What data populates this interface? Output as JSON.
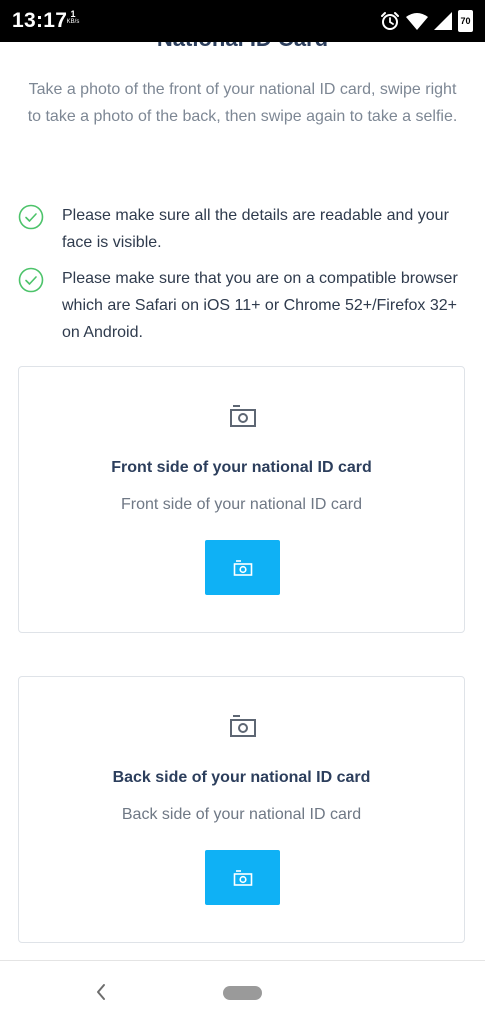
{
  "status_bar": {
    "time": "13:17",
    "net_speed_value": "1",
    "net_speed_unit": "KB/s",
    "battery_level": "70",
    "icons": [
      "alarm-icon",
      "wifi-icon",
      "signal-icon",
      "battery-icon"
    ]
  },
  "page": {
    "title": "National ID Card",
    "intro": "Take a photo of the front of your national ID card, swipe right to take a photo of the back, then swipe again to take a selfie."
  },
  "checklist": [
    {
      "icon": "check-circle-icon",
      "text": "Please make sure all the details are readable and your face is visible."
    },
    {
      "icon": "check-circle-icon",
      "text": "Please make sure that you are on a compatible browser which are Safari on iOS 11+ or Chrome 52+/Firefox 32+ on Android."
    }
  ],
  "cards": [
    {
      "icon": "camera-icon",
      "title": "Front side of your national ID card",
      "subtitle": "Front side of your national ID card",
      "button_icon": "camera-icon"
    },
    {
      "icon": "camera-icon",
      "title": "Back side of your national ID card",
      "subtitle": "Back side of your national ID card",
      "button_icon": "camera-icon"
    }
  ],
  "nav_bar": {
    "back_icon": "back-chevron-icon",
    "home_icon": "home-pill-icon"
  },
  "colors": {
    "accent": "#0fb1f5",
    "check_green": "#4cc36a",
    "title_navy": "#2c3e5c",
    "body_gray": "#7d8794"
  }
}
